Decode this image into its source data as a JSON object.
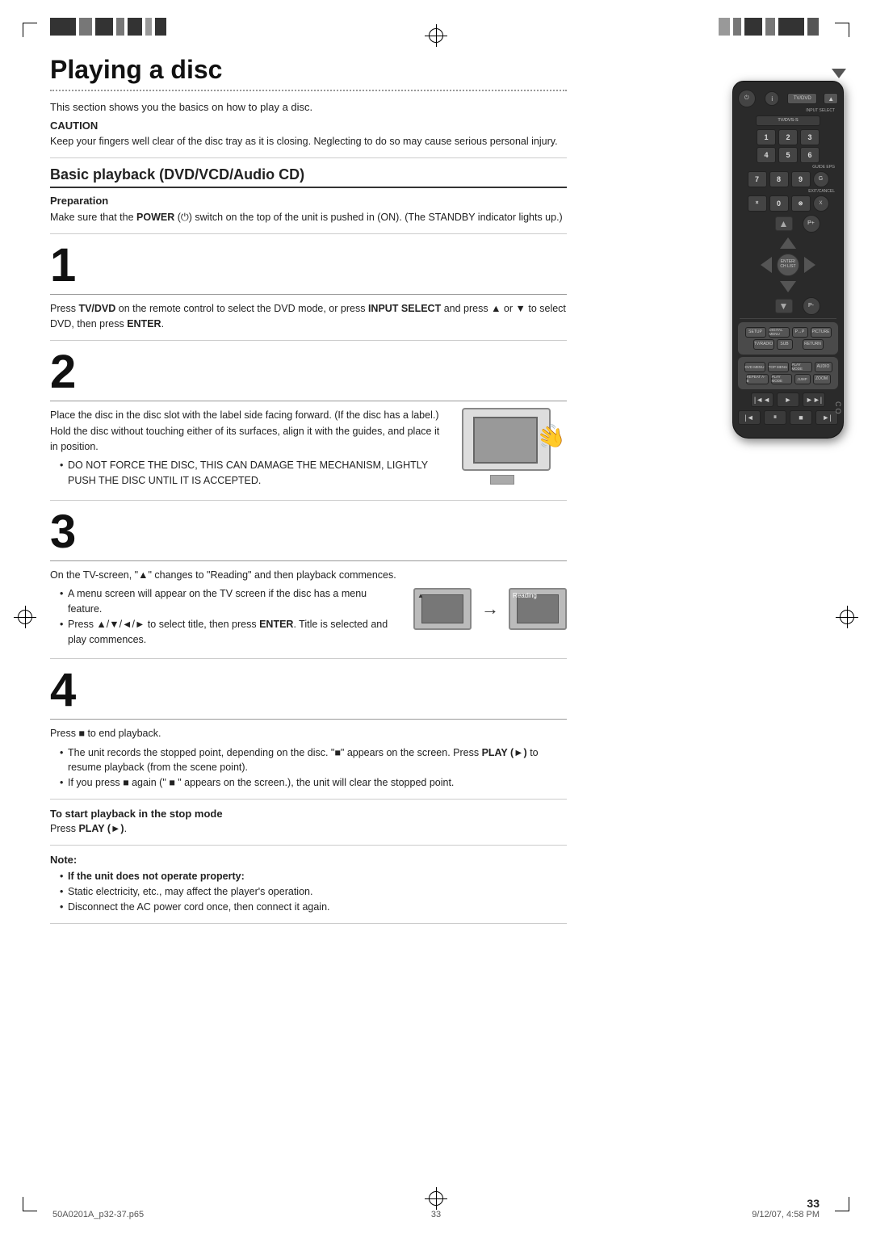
{
  "page": {
    "title": "Playing a disc",
    "number": "33",
    "footer_left": "50A0201A_p32-37.p65",
    "footer_center": "33",
    "footer_right": "9/12/07, 4:58 PM"
  },
  "header": {
    "bar_blocks": [
      28,
      14,
      18,
      10,
      14,
      8,
      18,
      12,
      22,
      10
    ],
    "right_bar_blocks": [
      22,
      10,
      18,
      12,
      28,
      14
    ]
  },
  "caution": {
    "label": "CAUTION",
    "text": "Keep your fingers well clear of the disc tray as it is closing. Neglecting to do so may cause serious personal injury."
  },
  "intro": {
    "text": "This section shows you the basics on how to play a disc."
  },
  "section": {
    "title": "Basic playback (DVD/VCD/Audio CD)"
  },
  "preparation": {
    "label": "Preparation",
    "text": "Make sure that the POWER (⏻) switch on the top of the unit is pushed in (ON). (The STANDBY indicator lights up.)"
  },
  "steps": [
    {
      "number": "1",
      "text": "Press TV/DVD on the remote control to select the DVD mode, or press INPUT SELECT and press ▲ or ▼ to select DVD, then press ENTER."
    },
    {
      "number": "2",
      "lines": [
        "Place the disc in the disc slot with the label side",
        "facing forward. (If the disc has a label.)",
        "Hold the disc without touching either of its surfaces,",
        "align it with the guides, and place it in position."
      ],
      "bullets": [
        "DO NOT FORCE THE DISC, THIS CAN DAMAGE THE MECHANISM, LIGHTLY PUSH THE DISC UNTIL IT IS ACCEPTED."
      ]
    },
    {
      "number": "3",
      "text": "On the TV-screen, \"▲\" changes to \"Reading\" and then playback commences.",
      "bullets": [
        "A menu screen will appear on the TV screen if the disc has a menu feature.",
        "Press ▲/▼/◄/► to select title, then press ENTER. Title is selected and play commences."
      ]
    },
    {
      "number": "4",
      "text": "Press ■ to end playback.",
      "bullets": [
        "The unit records the stopped point, depending on the disc. \"■\" appears on the screen. Press PLAY (►) to resume playback (from the scene point).",
        "If you press ■ again (\" ■ \" appears on the screen.), the unit will clear the stopped point."
      ]
    }
  ],
  "stop_mode": {
    "title": "To start playback in the stop mode",
    "text": "Press PLAY (►)."
  },
  "note": {
    "title": "Note:",
    "bullet_title": "If the unit does not operate property:",
    "bullets": [
      "Static electricity, etc., may affect the player's operation.",
      "Disconnect the AC power cord once, then connect it again."
    ]
  },
  "remote": {
    "buttons": {
      "power": "⏻",
      "info": "i",
      "tv_dvd": "TV/DVD",
      "eject": "▲",
      "input_select": "INPUT SELECT",
      "tv_dvd_s": "TV/DVS-S",
      "num1": "1",
      "num2": "2",
      "num3": "3",
      "num4": "4",
      "num5": "5",
      "num6": "6",
      "num7": "7",
      "num8": "8",
      "num9": "9",
      "num10": "×",
      "num0": "0",
      "guide": "⊗",
      "exit_cancel": "EXIT/CANCEL",
      "p_plus": "P+",
      "p_minus": "P-",
      "enter": "ENTER/\nCH LIST",
      "setup": "SETUP",
      "digital_menu": "DIGITAL MENU",
      "p_p": "P↔P",
      "picture": "PICTURE",
      "tv_radio": "TV/RADIO",
      "return": "RETURN",
      "dvd_menu": "DVD MENU",
      "top_menu": "TOP MENU",
      "play_mode": "PLAY MODE",
      "audio": "AUDIO",
      "repeat_a_b": "REPEAT A-B",
      "jump": "JUMP",
      "zoom": "ZOOM",
      "rew": "◄◄",
      "play": "►",
      "fwd": "►►",
      "prev": "|◄",
      "pause": "⏸",
      "stop": "■",
      "next": "►|"
    }
  }
}
